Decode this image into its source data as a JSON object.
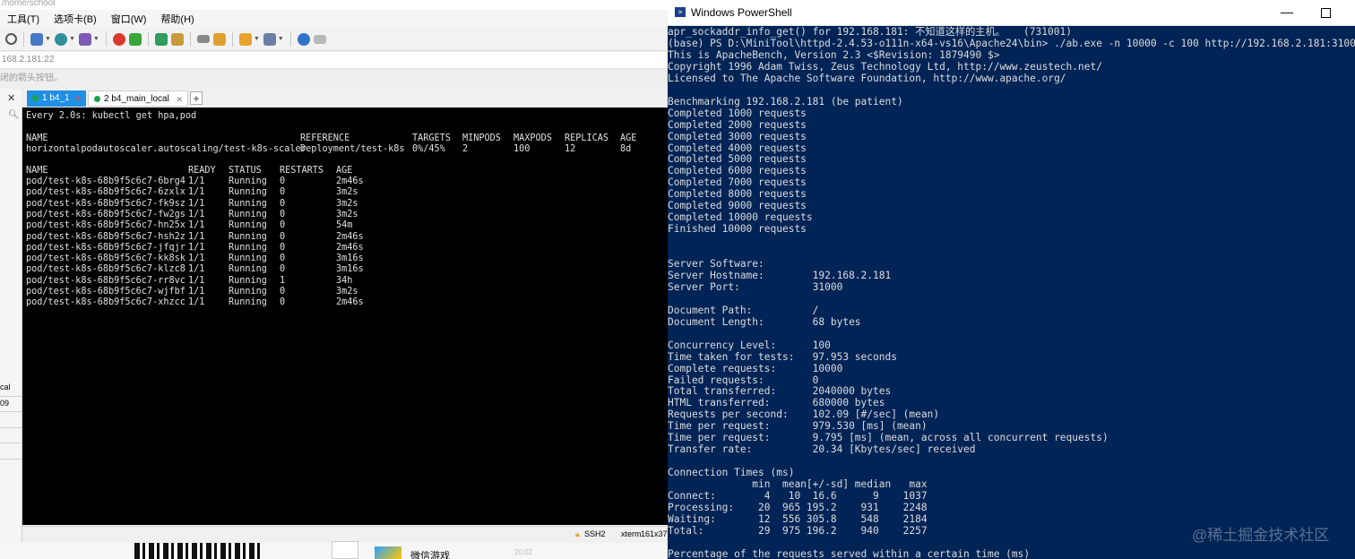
{
  "left_app": {
    "title_fragment": "/home/school",
    "menu": [
      "工具(T)",
      "选项卡(B)",
      "窗口(W)",
      "帮助(H)"
    ],
    "address": "168.2.181:22",
    "hint": "闭的箭头按钮。",
    "sidebar_fragments": [
      "cal",
      "09"
    ],
    "tabs": [
      {
        "number": "1",
        "label": "b4_1"
      },
      {
        "number": "2",
        "label": "b4_main_local"
      }
    ],
    "statusbar": {
      "protocol": "SSH2",
      "term": "xterm",
      "size": "161x37"
    },
    "bottom": {
      "wechat_label": "微信游戏",
      "ghost_time": "20:02"
    }
  },
  "terminal": {
    "header": "Every 2.0s: kubectl get hpa,pod",
    "hpa_headers": [
      "NAME",
      "REFERENCE",
      "TARGETS",
      "MINPODS",
      "MAXPODS",
      "REPLICAS",
      "AGE"
    ],
    "hpa_row": [
      "horizontalpodautoscaler.autoscaling/test-k8s-scaler",
      "Deployment/test-k8s",
      "0%/45%",
      "2",
      "100",
      "12",
      "8d"
    ],
    "pod_headers": [
      "NAME",
      "READY",
      "STATUS",
      "RESTARTS",
      "AGE"
    ],
    "pods": [
      [
        "pod/test-k8s-68b9f5c6c7-6brg4",
        "1/1",
        "Running",
        "0",
        "2m46s"
      ],
      [
        "pod/test-k8s-68b9f5c6c7-6zxlx",
        "1/1",
        "Running",
        "0",
        "3m2s"
      ],
      [
        "pod/test-k8s-68b9f5c6c7-fk9sz",
        "1/1",
        "Running",
        "0",
        "3m2s"
      ],
      [
        "pod/test-k8s-68b9f5c6c7-fw2gs",
        "1/1",
        "Running",
        "0",
        "3m2s"
      ],
      [
        "pod/test-k8s-68b9f5c6c7-hn25x",
        "1/1",
        "Running",
        "0",
        "54m"
      ],
      [
        "pod/test-k8s-68b9f5c6c7-hsh2z",
        "1/1",
        "Running",
        "0",
        "2m46s"
      ],
      [
        "pod/test-k8s-68b9f5c6c7-jfqjr",
        "1/1",
        "Running",
        "0",
        "2m46s"
      ],
      [
        "pod/test-k8s-68b9f5c6c7-kk8sk",
        "1/1",
        "Running",
        "0",
        "3m16s"
      ],
      [
        "pod/test-k8s-68b9f5c6c7-klzc8",
        "1/1",
        "Running",
        "0",
        "3m16s"
      ],
      [
        "pod/test-k8s-68b9f5c6c7-rr8vc",
        "1/1",
        "Running",
        "1",
        "34h"
      ],
      [
        "pod/test-k8s-68b9f5c6c7-wjfbf",
        "1/1",
        "Running",
        "0",
        "3m2s"
      ],
      [
        "pod/test-k8s-68b9f5c6c7-xhzcc",
        "1/1",
        "Running",
        "0",
        "2m46s"
      ]
    ]
  },
  "powershell": {
    "title": "Windows PowerShell",
    "lines": [
      "apr_sockaddr_info_get() for 192.168.181: 不知道这样的主机。   (731001)",
      "(base) PS D:\\MiniTool\\httpd-2.4.53-o111n-x64-vs16\\Apache24\\bin> ./ab.exe -n 10000 -c 100 http://192.168.2.181:31000/",
      "This is ApacheBench, Version 2.3 <$Revision: 1879490 $>",
      "Copyright 1996 Adam Twiss, Zeus Technology Ltd, http://www.zeustech.net/",
      "Licensed to The Apache Software Foundation, http://www.apache.org/",
      "",
      "Benchmarking 192.168.2.181 (be patient)",
      "Completed 1000 requests",
      "Completed 2000 requests",
      "Completed 3000 requests",
      "Completed 4000 requests",
      "Completed 5000 requests",
      "Completed 6000 requests",
      "Completed 7000 requests",
      "Completed 8000 requests",
      "Completed 9000 requests",
      "Completed 10000 requests",
      "Finished 10000 requests",
      "",
      "",
      "Server Software:",
      "Server Hostname:        192.168.2.181",
      "Server Port:            31000",
      "",
      "Document Path:          /",
      "Document Length:        68 bytes",
      "",
      "Concurrency Level:      100",
      "Time taken for tests:   97.953 seconds",
      "Complete requests:      10000",
      "Failed requests:        0",
      "Total transferred:      2040000 bytes",
      "HTML transferred:       680000 bytes",
      "Requests per second:    102.09 [#/sec] (mean)",
      "Time per request:       979.530 [ms] (mean)",
      "Time per request:       9.795 [ms] (mean, across all concurrent requests)",
      "Transfer rate:          20.34 [Kbytes/sec] received",
      "",
      "Connection Times (ms)",
      "              min  mean[+/-sd] median   max",
      "Connect:        4   10  16.6      9    1037",
      "Processing:    20  965 195.2    931    2248",
      "Waiting:       12  556 305.8    548    2184",
      "Total:         29  975 196.2    940    2257",
      "",
      "Percentage of the requests served within a certain time (ms)"
    ]
  },
  "watermark": "@稀土掘金技术社区"
}
